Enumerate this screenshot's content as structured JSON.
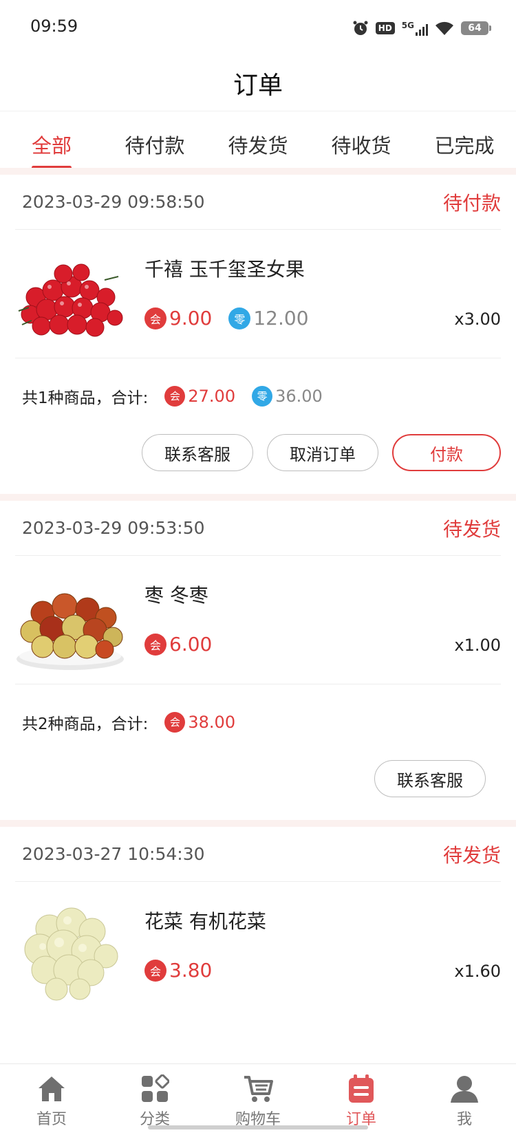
{
  "status_bar": {
    "time": "09:59",
    "network": "5G",
    "hd": "HD",
    "battery": "64"
  },
  "header": {
    "title": "订单"
  },
  "tabs": [
    {
      "label": "全部",
      "active": true
    },
    {
      "label": "待付款",
      "active": false
    },
    {
      "label": "待发货",
      "active": false
    },
    {
      "label": "待收货",
      "active": false
    },
    {
      "label": "已完成",
      "active": false
    }
  ],
  "badges": {
    "member": "会",
    "retail": "零"
  },
  "orders": [
    {
      "date": "2023-03-29 09:58:50",
      "status": "待付款",
      "product": {
        "name": "千禧 玉千玺圣女果",
        "member_price": "9.00",
        "retail_price": "12.00",
        "qty": "x3.00",
        "image": "cherry-tomatoes"
      },
      "summary": {
        "label": "共1种商品，合计:",
        "member_total": "27.00",
        "retail_total": "36.00"
      },
      "actions": [
        "联系客服",
        "取消订单",
        "付款"
      ]
    },
    {
      "date": "2023-03-29 09:53:50",
      "status": "待发货",
      "product": {
        "name": "枣 冬枣",
        "member_price": "6.00",
        "qty": "x1.00",
        "image": "jujubes"
      },
      "summary": {
        "label": "共2种商品，合计:",
        "member_total": "38.00"
      },
      "actions": [
        "联系客服"
      ]
    },
    {
      "date": "2023-03-27 10:54:30",
      "status": "待发货",
      "product": {
        "name": "花菜 有机花菜",
        "member_price": "3.80",
        "qty": "x1.60",
        "image": "cauliflower"
      }
    }
  ],
  "bottom_nav": [
    {
      "label": "首页",
      "icon": "home-icon",
      "active": false
    },
    {
      "label": "分类",
      "icon": "category-icon",
      "active": false
    },
    {
      "label": "购物车",
      "icon": "cart-icon",
      "active": false
    },
    {
      "label": "订单",
      "icon": "orders-icon",
      "active": true
    },
    {
      "label": "我",
      "icon": "user-icon",
      "active": false
    }
  ],
  "colors": {
    "accent": "#e03c3c",
    "retail_badge": "#31a8e6",
    "section_gap": "#fbf1ef"
  }
}
